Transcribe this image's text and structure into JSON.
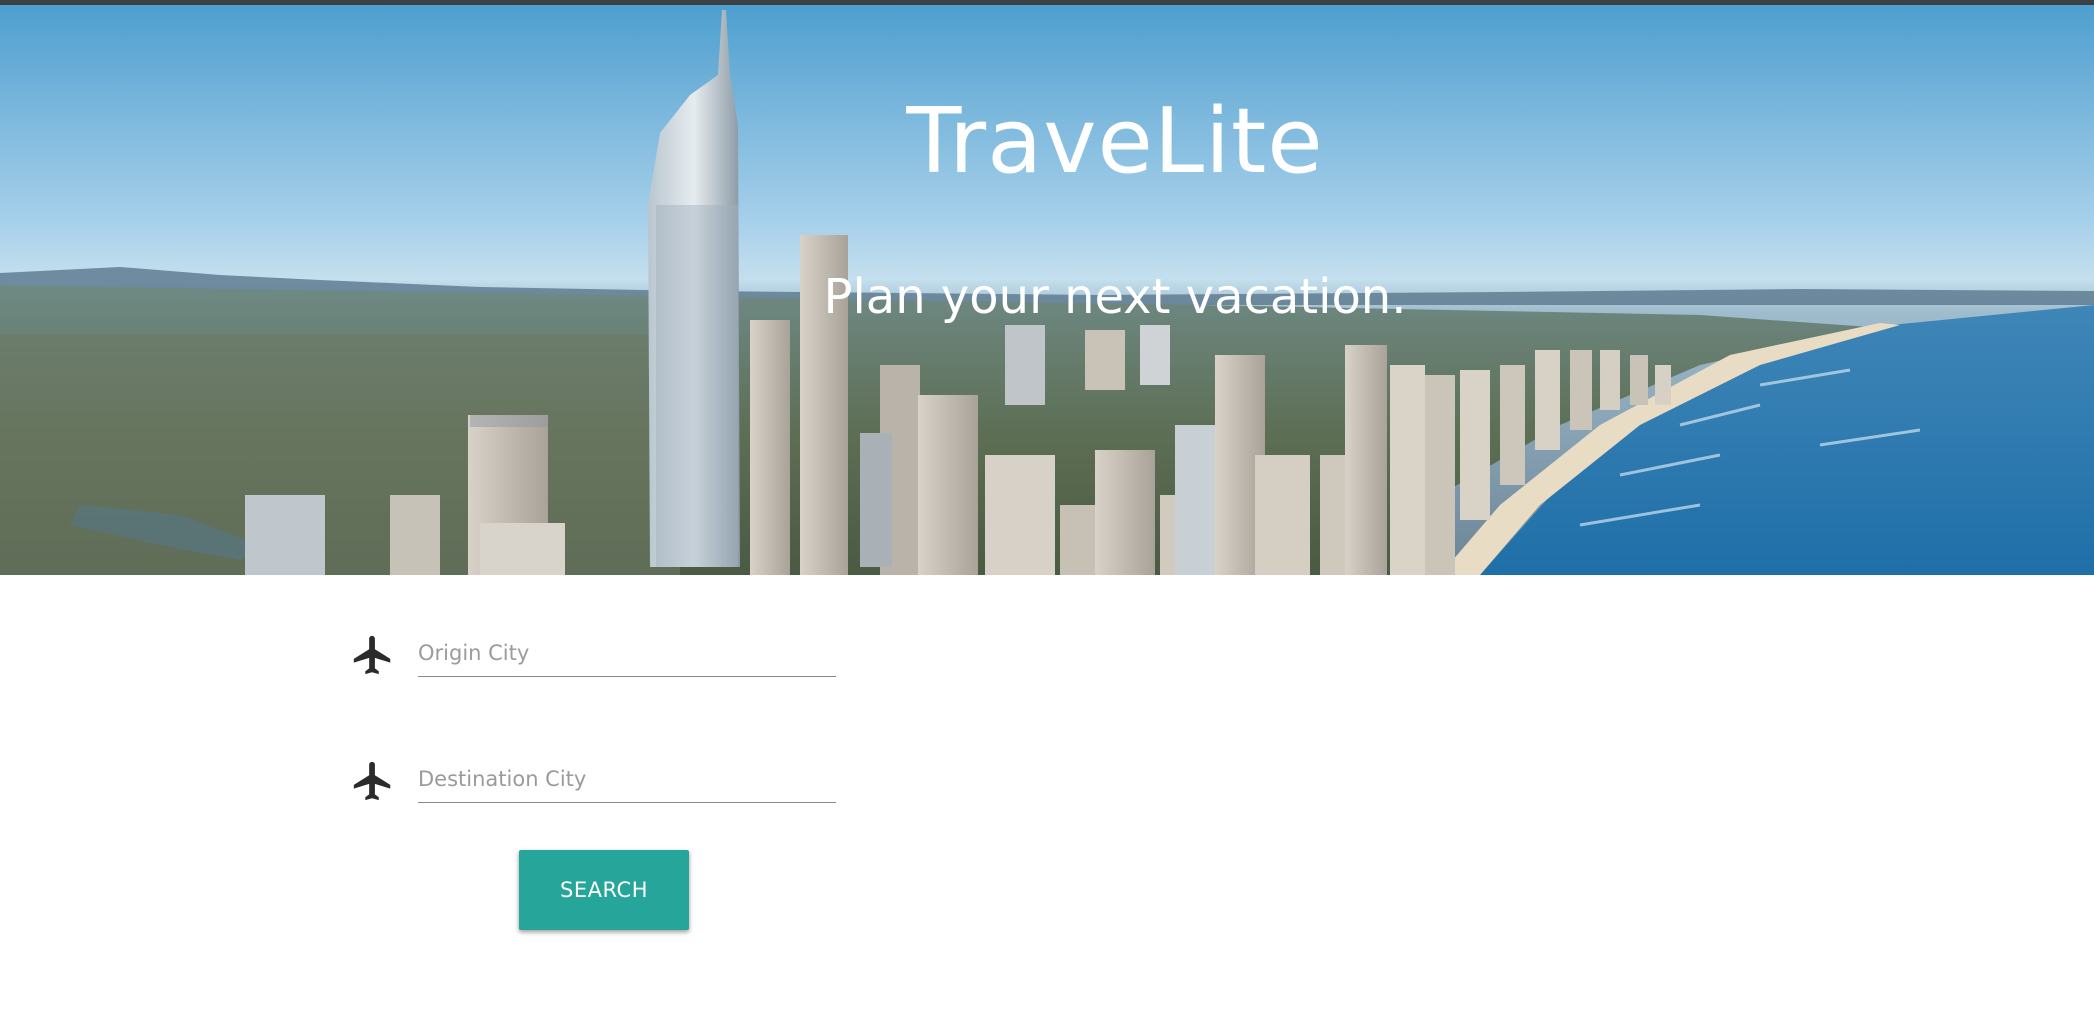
{
  "hero": {
    "title": "TraveLite",
    "subtitle": "Plan your next vacation."
  },
  "form": {
    "origin": {
      "icon": "airplane-icon",
      "placeholder": "Origin City",
      "value": ""
    },
    "destination": {
      "icon": "airplane-icon",
      "placeholder": "Destination City",
      "value": ""
    },
    "search_label": "SEARCH"
  },
  "colors": {
    "accent": "#26a69a",
    "hero_text": "#ffffff",
    "icon": "#2b2b2b",
    "underline": "#8a8a8a"
  }
}
